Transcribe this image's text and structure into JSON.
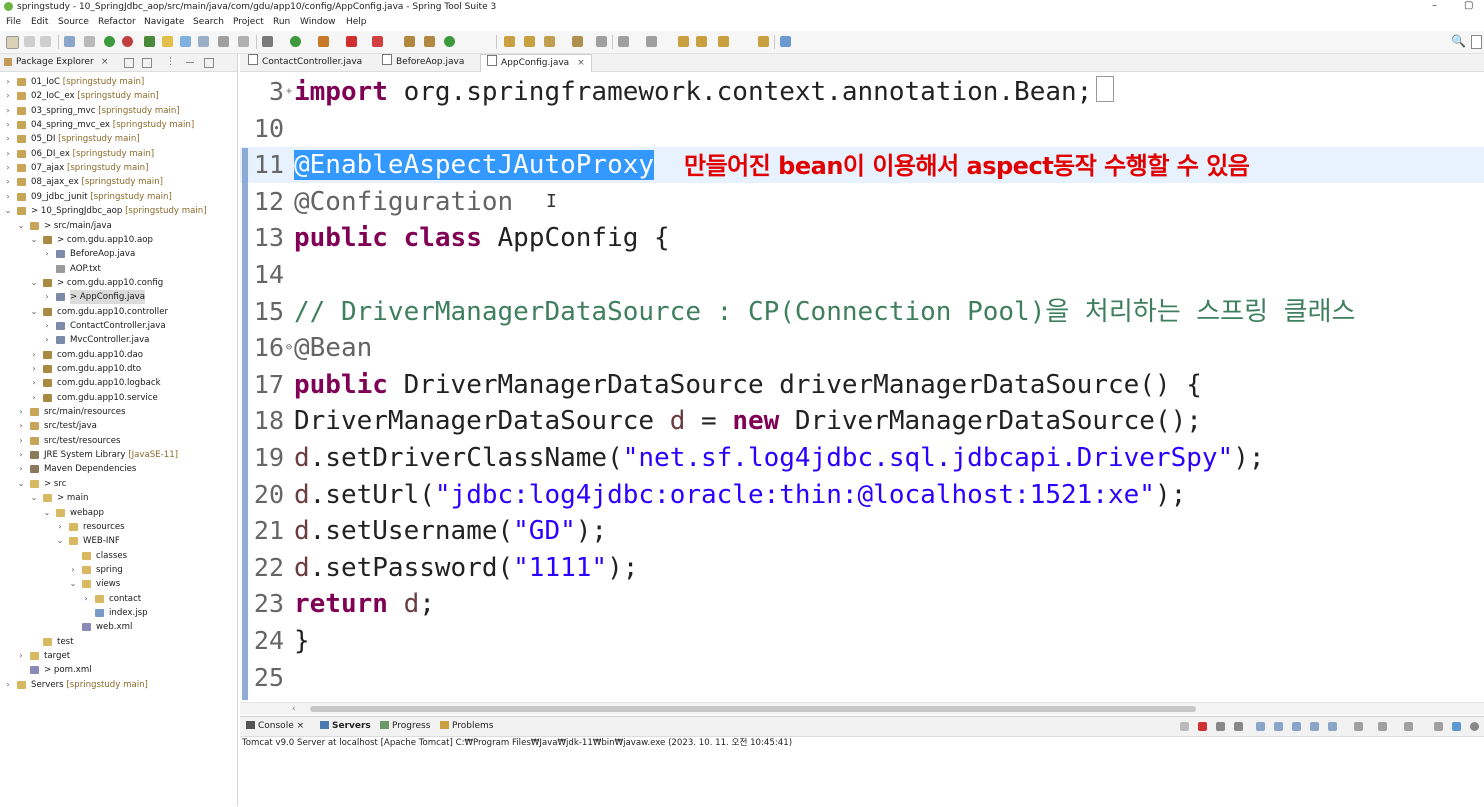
{
  "window": {
    "title": "springstudy - 10_SpringJdbc_aop/src/main/java/com/gdu/app10/config/AppConfig.java - Spring Tool Suite 3",
    "minimize": "–",
    "restore": "▢"
  },
  "menu": [
    "File",
    "Edit",
    "Source",
    "Refactor",
    "Navigate",
    "Search",
    "Project",
    "Run",
    "Window",
    "Help"
  ],
  "package_explorer": {
    "title": "Package Explorer",
    "close": "×",
    "items": [
      {
        "label": "01_IoC",
        "deco": " [springstudy main]",
        "indent": 0,
        "twisty": "›",
        "icon": "project-icon"
      },
      {
        "label": "02_IoC_ex",
        "deco": " [springstudy main]",
        "indent": 0,
        "twisty": "›",
        "icon": "project-icon"
      },
      {
        "label": "03_spring_mvc",
        "deco": " [springstudy main]",
        "indent": 0,
        "twisty": "›",
        "icon": "project-icon"
      },
      {
        "label": "04_spring_mvc_ex",
        "deco": " [springstudy main]",
        "indent": 0,
        "twisty": "›",
        "icon": "project-icon"
      },
      {
        "label": "05_DI",
        "deco": " [springstudy main]",
        "indent": 0,
        "twisty": "›",
        "icon": "project-icon"
      },
      {
        "label": "06_DI_ex",
        "deco": " [springstudy main]",
        "indent": 0,
        "twisty": "›",
        "icon": "project-icon"
      },
      {
        "label": "07_ajax",
        "deco": " [springstudy main]",
        "indent": 0,
        "twisty": "›",
        "icon": "project-icon"
      },
      {
        "label": "08_ajax_ex",
        "deco": " [springstudy main]",
        "indent": 0,
        "twisty": "›",
        "icon": "project-icon"
      },
      {
        "label": "09_jdbc_junit",
        "deco": " [springstudy main]",
        "indent": 0,
        "twisty": "›",
        "icon": "project-icon"
      },
      {
        "label": "> 10_SpringJdbc_aop",
        "deco": " [springstudy main]",
        "indent": 0,
        "twisty": "⌄",
        "icon": "project-icon"
      },
      {
        "label": "> src/main/java",
        "deco": "",
        "indent": 1,
        "twisty": "⌄",
        "icon": "source-folder-icon"
      },
      {
        "label": "> com.gdu.app10.aop",
        "deco": "",
        "indent": 2,
        "twisty": "⌄",
        "icon": "package-icon"
      },
      {
        "label": "BeforeAop.java",
        "deco": "",
        "indent": 3,
        "twisty": "›",
        "icon": "java-file-icon"
      },
      {
        "label": "AOP.txt",
        "deco": "",
        "indent": 3,
        "twisty": "",
        "icon": "text-file-icon"
      },
      {
        "label": "> com.gdu.app10.config",
        "deco": "",
        "indent": 2,
        "twisty": "⌄",
        "icon": "package-icon"
      },
      {
        "label": "> AppConfig.java",
        "deco": "",
        "indent": 3,
        "twisty": "›",
        "icon": "java-file-icon",
        "selected": true
      },
      {
        "label": "com.gdu.app10.controller",
        "deco": "",
        "indent": 2,
        "twisty": "⌄",
        "icon": "package-icon"
      },
      {
        "label": "ContactController.java",
        "deco": "",
        "indent": 3,
        "twisty": "›",
        "icon": "java-file-icon"
      },
      {
        "label": "MvcController.java",
        "deco": "",
        "indent": 3,
        "twisty": "›",
        "icon": "java-file-icon"
      },
      {
        "label": "com.gdu.app10.dao",
        "deco": "",
        "indent": 2,
        "twisty": "›",
        "icon": "package-icon"
      },
      {
        "label": "com.gdu.app10.dto",
        "deco": "",
        "indent": 2,
        "twisty": "›",
        "icon": "package-icon"
      },
      {
        "label": "com.gdu.app10.logback",
        "deco": "",
        "indent": 2,
        "twisty": "›",
        "icon": "package-icon"
      },
      {
        "label": "com.gdu.app10.service",
        "deco": "",
        "indent": 2,
        "twisty": "›",
        "icon": "package-icon"
      },
      {
        "label": "src/main/resources",
        "deco": "",
        "indent": 1,
        "twisty": "›",
        "icon": "source-folder-icon"
      },
      {
        "label": "src/test/java",
        "deco": "",
        "indent": 1,
        "twisty": "›",
        "icon": "source-folder-icon"
      },
      {
        "label": "src/test/resources",
        "deco": "",
        "indent": 1,
        "twisty": "›",
        "icon": "source-folder-icon"
      },
      {
        "label": "JRE System Library",
        "deco": " [JavaSE-11]",
        "indent": 1,
        "twisty": "›",
        "icon": "library-icon"
      },
      {
        "label": "Maven Dependencies",
        "deco": "",
        "indent": 1,
        "twisty": "›",
        "icon": "library-icon"
      },
      {
        "label": "> src",
        "deco": "",
        "indent": 1,
        "twisty": "⌄",
        "icon": "folder-icon"
      },
      {
        "label": "> main",
        "deco": "",
        "indent": 2,
        "twisty": "⌄",
        "icon": "folder-icon"
      },
      {
        "label": "webapp",
        "deco": "",
        "indent": 3,
        "twisty": "⌄",
        "icon": "folder-icon"
      },
      {
        "label": "resources",
        "deco": "",
        "indent": 4,
        "twisty": "›",
        "icon": "folder-icon"
      },
      {
        "label": "WEB-INF",
        "deco": "",
        "indent": 4,
        "twisty": "⌄",
        "icon": "folder-icon"
      },
      {
        "label": "classes",
        "deco": "",
        "indent": 5,
        "twisty": "",
        "icon": "folder-icon"
      },
      {
        "label": "spring",
        "deco": "",
        "indent": 5,
        "twisty": "›",
        "icon": "folder-icon"
      },
      {
        "label": "views",
        "deco": "",
        "indent": 5,
        "twisty": "⌄",
        "icon": "folder-icon"
      },
      {
        "label": "contact",
        "deco": "",
        "indent": 6,
        "twisty": "›",
        "icon": "folder-icon"
      },
      {
        "label": "index.jsp",
        "deco": "",
        "indent": 6,
        "twisty": "",
        "icon": "jsp-file-icon"
      },
      {
        "label": "web.xml",
        "deco": "",
        "indent": 5,
        "twisty": "",
        "icon": "xml-file-icon"
      },
      {
        "label": "test",
        "deco": "",
        "indent": 2,
        "twisty": "",
        "icon": "folder-icon"
      },
      {
        "label": "target",
        "deco": "",
        "indent": 1,
        "twisty": "›",
        "icon": "folder-icon"
      },
      {
        "label": "> pom.xml",
        "deco": "",
        "indent": 1,
        "twisty": "",
        "icon": "xml-file-icon"
      },
      {
        "label": "Servers",
        "deco": " [springstudy main]",
        "indent": 0,
        "twisty": "›",
        "icon": "folder-icon"
      }
    ]
  },
  "editor": {
    "tabs": [
      {
        "label": "ContactController.java",
        "active": false
      },
      {
        "label": "BeforeAop.java",
        "active": false
      },
      {
        "label": "AppConfig.java",
        "active": true,
        "close": "×"
      }
    ],
    "annotation_note": "만들어진 bean이 이용해서 aspect동작 수행할 수 있음",
    "lines": [
      {
        "n": "3",
        "fold": "+",
        "parts": [
          [
            "kw",
            "import"
          ],
          [
            "plain",
            " org.springframework.context.annotation.Bean;"
          ]
        ],
        "box": true
      },
      {
        "n": "10",
        "parts": []
      },
      {
        "n": "11",
        "current": true,
        "parts": [
          [
            "sel",
            "@EnableAspectJAutoProxy"
          ]
        ]
      },
      {
        "n": "12",
        "parts": [
          [
            "ann",
            "@Configuration"
          ]
        ]
      },
      {
        "n": "13",
        "parts": [
          [
            "kw",
            "public"
          ],
          [
            "plain",
            " "
          ],
          [
            "kw",
            "class"
          ],
          [
            "plain",
            " AppConfig {"
          ]
        ]
      },
      {
        "n": "14",
        "parts": []
      },
      {
        "n": "15",
        "parts": [
          [
            "plain",
            "  "
          ],
          [
            "cmt",
            "// DriverManagerDataSource : CP(Connection Pool)을 처리하는 스프링 클래스"
          ]
        ]
      },
      {
        "n": "16",
        "fold": "⊖",
        "parts": [
          [
            "plain",
            "  "
          ],
          [
            "ann",
            "@Bean"
          ]
        ]
      },
      {
        "n": "17",
        "parts": [
          [
            "plain",
            "  "
          ],
          [
            "kw",
            "public"
          ],
          [
            "plain",
            " DriverManagerDataSource driverManagerDataSource() {"
          ]
        ]
      },
      {
        "n": "18",
        "parts": [
          [
            "plain",
            "    DriverManagerDataSource "
          ],
          [
            "var",
            "d"
          ],
          [
            "plain",
            " = "
          ],
          [
            "kw",
            "new"
          ],
          [
            "plain",
            " DriverManagerDataSource();"
          ]
        ]
      },
      {
        "n": "19",
        "parts": [
          [
            "plain",
            "    "
          ],
          [
            "var",
            "d"
          ],
          [
            "plain",
            ".setDriverClassName("
          ],
          [
            "str",
            "\"net.sf.log4jdbc.sql.jdbcapi.DriverSpy\""
          ],
          [
            "plain",
            ");"
          ]
        ]
      },
      {
        "n": "20",
        "parts": [
          [
            "plain",
            "    "
          ],
          [
            "var",
            "d"
          ],
          [
            "plain",
            ".setUrl("
          ],
          [
            "str",
            "\"jdbc:log4jdbc:oracle:thin:@localhost:1521:xe\""
          ],
          [
            "plain",
            ");"
          ]
        ]
      },
      {
        "n": "21",
        "parts": [
          [
            "plain",
            "    "
          ],
          [
            "var",
            "d"
          ],
          [
            "plain",
            ".setUsername("
          ],
          [
            "str",
            "\"GD\""
          ],
          [
            "plain",
            ");"
          ]
        ]
      },
      {
        "n": "22",
        "parts": [
          [
            "plain",
            "    "
          ],
          [
            "var",
            "d"
          ],
          [
            "plain",
            ".setPassword("
          ],
          [
            "str",
            "\"1111\""
          ],
          [
            "plain",
            ");"
          ]
        ]
      },
      {
        "n": "23",
        "parts": [
          [
            "plain",
            "    "
          ],
          [
            "kw",
            "return"
          ],
          [
            "plain",
            " "
          ],
          [
            "var",
            "d"
          ],
          [
            "plain",
            ";"
          ]
        ]
      },
      {
        "n": "24",
        "parts": [
          [
            "plain",
            "  }"
          ]
        ]
      },
      {
        "n": "25",
        "parts": []
      }
    ]
  },
  "console": {
    "tabs": [
      {
        "label": "Console",
        "close": "×",
        "active": false
      },
      {
        "label": "Servers",
        "active": true
      },
      {
        "label": "Progress",
        "active": false
      },
      {
        "label": "Problems",
        "active": false
      }
    ],
    "status": "Tomcat v9.0 Server at localhost [Apache Tomcat] C:₩Program Files₩Java₩jdk-11₩bin₩javaw.exe  (2023. 10. 11. 오전 10:45:41)"
  },
  "colors": {
    "keyword": "#7f0055",
    "string": "#2a00ff",
    "comment": "#3f7f5f",
    "selection": "#3399ff",
    "note": "#e00000"
  }
}
